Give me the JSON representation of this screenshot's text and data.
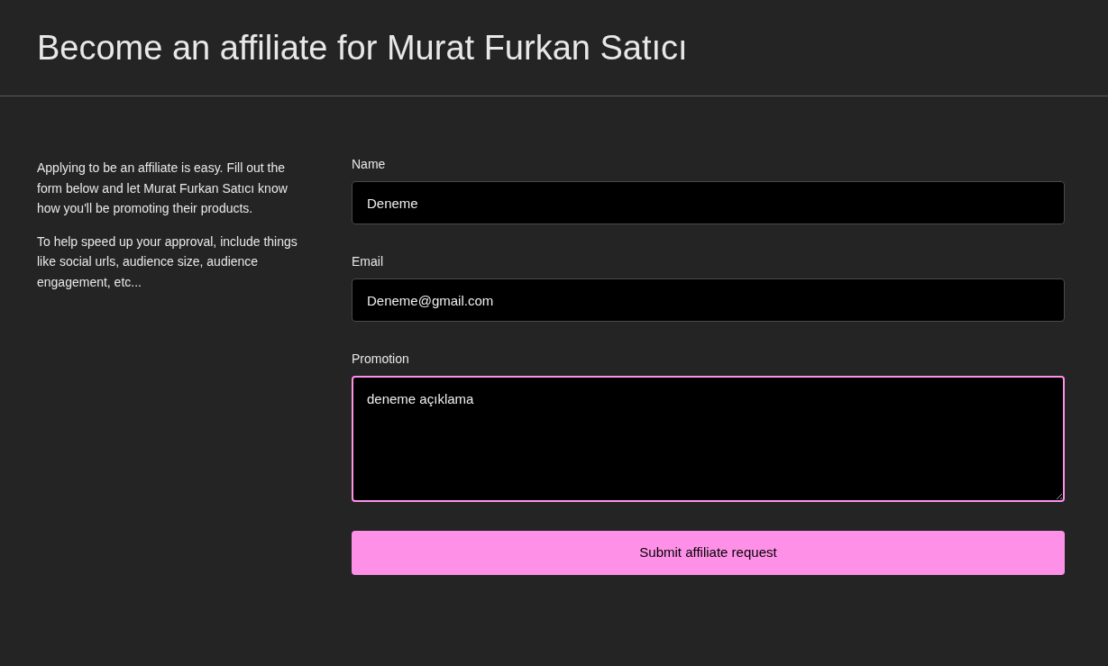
{
  "header": {
    "title": "Become an affiliate for Murat Furkan Satıcı"
  },
  "intro": {
    "paragraphs": [
      "Applying to be an affiliate is easy. Fill out the form below and let Murat Furkan Satıcı know how you'll be promoting their products.",
      "To help speed up your approval, include things like social urls, audience size, audience engagement, etc..."
    ]
  },
  "form": {
    "fields": [
      {
        "kind": "input",
        "label": "Name",
        "value": "Deneme",
        "focused": false
      },
      {
        "kind": "input",
        "label": "Email",
        "value": "Deneme@gmail.com",
        "focused": false
      },
      {
        "kind": "textarea",
        "label": "Promotion",
        "value": "deneme açıklama",
        "focused": true
      }
    ],
    "submit": "Submit affiliate request"
  }
}
